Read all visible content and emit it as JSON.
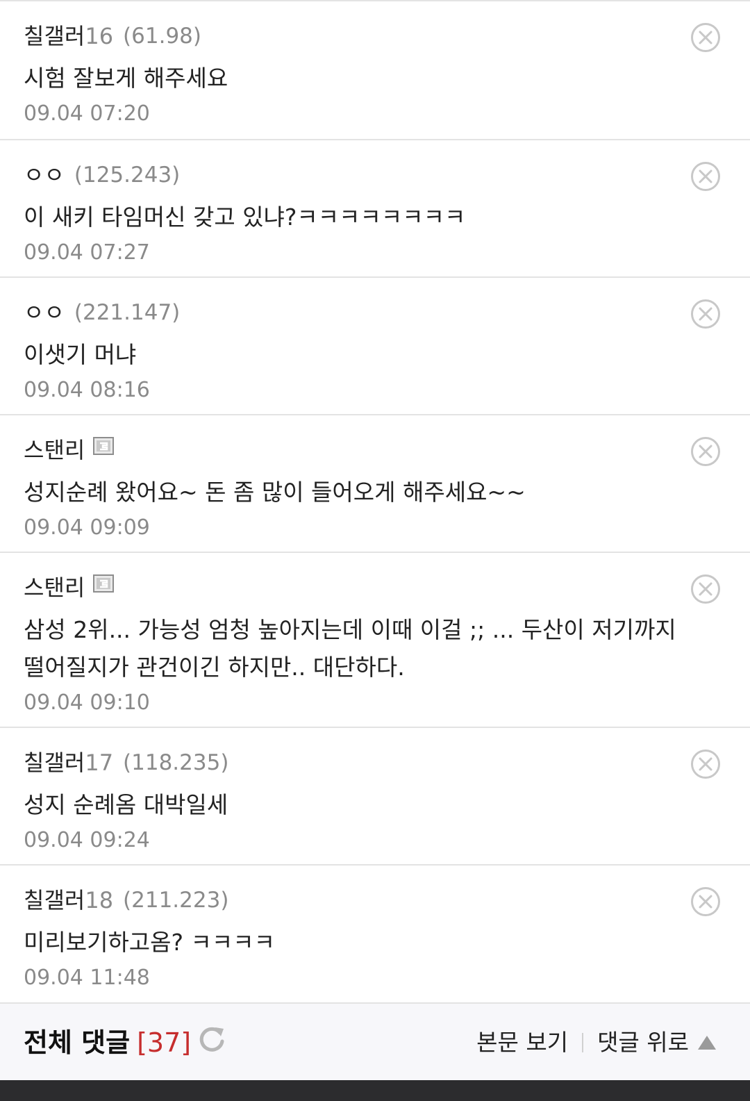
{
  "comments": [
    {
      "nick": "칠갤러",
      "nick_num": "16",
      "ip": "(61.98)",
      "text": "시험 잘보게 해주세요",
      "date": "09.04 07:20",
      "badge": false
    },
    {
      "nick": "ㅇㅇ",
      "nick_num": "",
      "ip": "(125.243)",
      "text": "이 새키 타임머신 갖고 있냐?ㅋㅋㅋㅋㅋㅋㅋㅋ",
      "date": "09.04 07:27",
      "badge": false
    },
    {
      "nick": "ㅇㅇ",
      "nick_num": "",
      "ip": "(221.147)",
      "text": "이샛기 머냐",
      "date": "09.04 08:16",
      "badge": false
    },
    {
      "nick": "스탠리",
      "nick_num": "",
      "ip": "",
      "text": "성지순례 왔어요~ 돈 좀 많이 들어오게 해주세요~~",
      "date": "09.04 09:09",
      "badge": true
    },
    {
      "nick": "스탠리",
      "nick_num": "",
      "ip": "",
      "text": "삼성 2위... 가능성 엄청 높아지는데 이때 이걸 ;; ... 두산이 저기까지 떨어질지가 관건이긴 하지만.. 대단하다.",
      "date": "09.04 09:10",
      "badge": true
    },
    {
      "nick": "칠갤러",
      "nick_num": "17",
      "ip": "(118.235)",
      "text": "성지 순례옴 대박일세",
      "date": "09.04 09:24",
      "badge": false
    },
    {
      "nick": "칠갤러",
      "nick_num": "18",
      "ip": "(211.223)",
      "text": "미리보기하고옴? ㅋㅋㅋㅋ",
      "date": "09.04 11:48",
      "badge": false
    }
  ],
  "footer": {
    "title": "전체 댓글",
    "count": "[37]",
    "view_post": "본문 보기",
    "to_top": "댓글 위로"
  },
  "colors": {
    "accent": "#c62d2d",
    "meta": "#8a8a8a",
    "divider": "#e3e3e3"
  },
  "icons": {
    "delete": "close-circle-icon",
    "refresh": "refresh-icon",
    "badge": "fixed-nick-icon",
    "up": "triangle-up-icon"
  }
}
